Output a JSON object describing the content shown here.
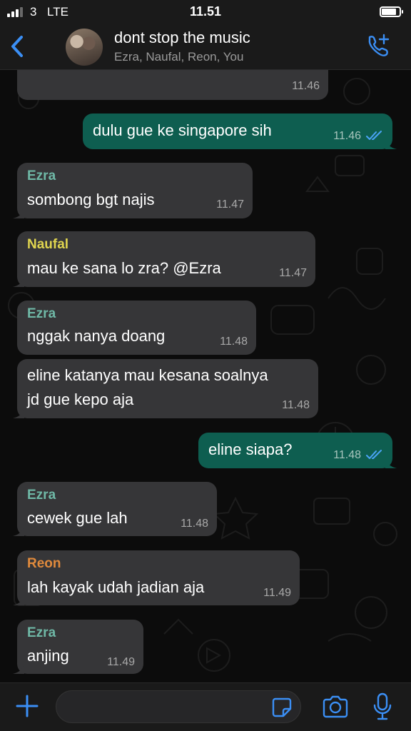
{
  "status_bar": {
    "carrier": "3",
    "network": "LTE",
    "time": "11.51"
  },
  "header": {
    "back_icon": "chevron-left-icon",
    "title": "dont stop the music",
    "members": "Ezra, Naufal, Reon, You",
    "call_icon": "phone-add-icon"
  },
  "colors": {
    "accent": "#3b8ff5",
    "incoming_bubble": "#363638",
    "outgoing_bubble": "#0e5e50",
    "sender_ezra": "#6fb8a6",
    "sender_naufal": "#e0d54f",
    "sender_reon": "#e08a3c"
  },
  "messages": [
    {
      "direction": "in",
      "sender": "",
      "text": "",
      "time": "11.46"
    },
    {
      "direction": "out",
      "text": "dulu gue ke singapore sih",
      "time": "11.46",
      "read": true
    },
    {
      "direction": "in",
      "sender": "Ezra",
      "text": "sombong bgt najis",
      "time": "11.47"
    },
    {
      "direction": "in",
      "sender": "Naufal",
      "text": "mau ke sana lo zra? @Ezra",
      "time": "11.47"
    },
    {
      "direction": "in",
      "sender": "Ezra",
      "text": "nggak nanya doang",
      "time": "11.48"
    },
    {
      "direction": "in",
      "sender": "",
      "text": "eline katanya mau kesana soalnya",
      "text2": "jd gue kepo aja",
      "time": "11.48"
    },
    {
      "direction": "out",
      "text": "eline siapa?",
      "time": "11.48",
      "read": true
    },
    {
      "direction": "in",
      "sender": "Ezra",
      "text": "cewek gue lah",
      "time": "11.48"
    },
    {
      "direction": "in",
      "sender": "Reon",
      "text": "lah kayak udah jadian aja",
      "time": "11.49"
    },
    {
      "direction": "in",
      "sender": "Ezra",
      "text": "anjing",
      "time": "11.49"
    }
  ],
  "input_bar": {
    "plus_icon": "plus-icon",
    "placeholder": "",
    "sticker_icon": "sticker-icon",
    "camera_icon": "camera-icon",
    "mic_icon": "microphone-icon"
  }
}
